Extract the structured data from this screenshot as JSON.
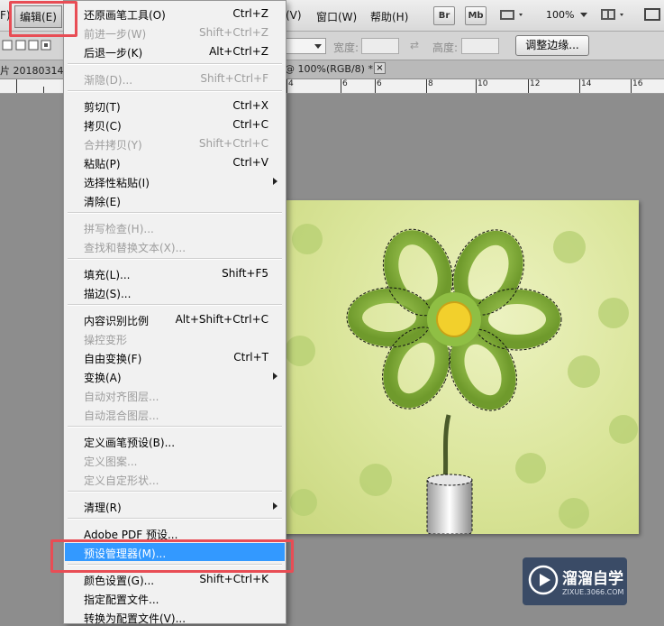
{
  "menubar": {
    "left_fragment": "F)",
    "edit_menu": "编辑(E)",
    "view": "(V)",
    "window": "窗口(W)",
    "help": "帮助(H)",
    "br_badge": "Br",
    "mb_badge": "Mb",
    "zoom": "100%"
  },
  "options": {
    "width_label": "宽度:",
    "height_label": "高度:",
    "refine_edge": "调整边缘..."
  },
  "tabs": {
    "left_tab": "片 20180314",
    "doc_tab": "@ 100%(RGB/8) *",
    "close": "×"
  },
  "ruler": {
    "labels": [
      "4",
      "6",
      "8",
      "10",
      "12",
      "14",
      "16"
    ]
  },
  "menu": {
    "items": [
      {
        "label": "还原画笔工具(O)",
        "shortcut": "Ctrl+Z",
        "disabled": false
      },
      {
        "label": "前进一步(W)",
        "shortcut": "Shift+Ctrl+Z",
        "disabled": true
      },
      {
        "label": "后退一步(K)",
        "shortcut": "Alt+Ctrl+Z",
        "disabled": false
      },
      {
        "label": "渐隐(D)...",
        "shortcut": "Shift+Ctrl+F",
        "disabled": true
      },
      {
        "label": "剪切(T)",
        "shortcut": "Ctrl+X",
        "disabled": false
      },
      {
        "label": "拷贝(C)",
        "shortcut": "Ctrl+C",
        "disabled": false
      },
      {
        "label": "合并拷贝(Y)",
        "shortcut": "Shift+Ctrl+C",
        "disabled": true
      },
      {
        "label": "粘贴(P)",
        "shortcut": "Ctrl+V",
        "disabled": false
      },
      {
        "label": "选择性粘贴(I)",
        "shortcut": "",
        "disabled": false,
        "submenu": true
      },
      {
        "label": "清除(E)",
        "shortcut": "",
        "disabled": false
      },
      {
        "label": "拼写检查(H)...",
        "shortcut": "",
        "disabled": true
      },
      {
        "label": "查找和替换文本(X)...",
        "shortcut": "",
        "disabled": true
      },
      {
        "label": "填充(L)...",
        "shortcut": "Shift+F5",
        "disabled": false
      },
      {
        "label": "描边(S)...",
        "shortcut": "",
        "disabled": false
      },
      {
        "label": "内容识别比例",
        "shortcut": "Alt+Shift+Ctrl+C",
        "disabled": false
      },
      {
        "label": "操控变形",
        "shortcut": "",
        "disabled": true
      },
      {
        "label": "自由变换(F)",
        "shortcut": "Ctrl+T",
        "disabled": false
      },
      {
        "label": "变换(A)",
        "shortcut": "",
        "disabled": false,
        "submenu": true
      },
      {
        "label": "自动对齐图层...",
        "shortcut": "",
        "disabled": true
      },
      {
        "label": "自动混合图层...",
        "shortcut": "",
        "disabled": true
      },
      {
        "label": "定义画笔预设(B)...",
        "shortcut": "",
        "disabled": false
      },
      {
        "label": "定义图案...",
        "shortcut": "",
        "disabled": true
      },
      {
        "label": "定义自定形状...",
        "shortcut": "",
        "disabled": true
      },
      {
        "label": "清理(R)",
        "shortcut": "",
        "disabled": false,
        "submenu": true
      },
      {
        "label": "Adobe PDF 预设...",
        "shortcut": "",
        "disabled": false
      },
      {
        "label": "预设管理器(M)...",
        "shortcut": "",
        "disabled": false,
        "highlighted": true
      },
      {
        "label": "颜色设置(G)...",
        "shortcut": "Shift+Ctrl+K",
        "disabled": false
      },
      {
        "label": "指定配置文件...",
        "shortcut": "",
        "disabled": false
      },
      {
        "label": "转换为配置文件(V)...",
        "shortcut": "",
        "disabled": false
      }
    ]
  },
  "watermark": {
    "title": "溜溜自学",
    "url": "ZIXUE.3066.COM"
  },
  "colors": {
    "highlight": "#3399ff",
    "annotation": "#e84d55"
  }
}
